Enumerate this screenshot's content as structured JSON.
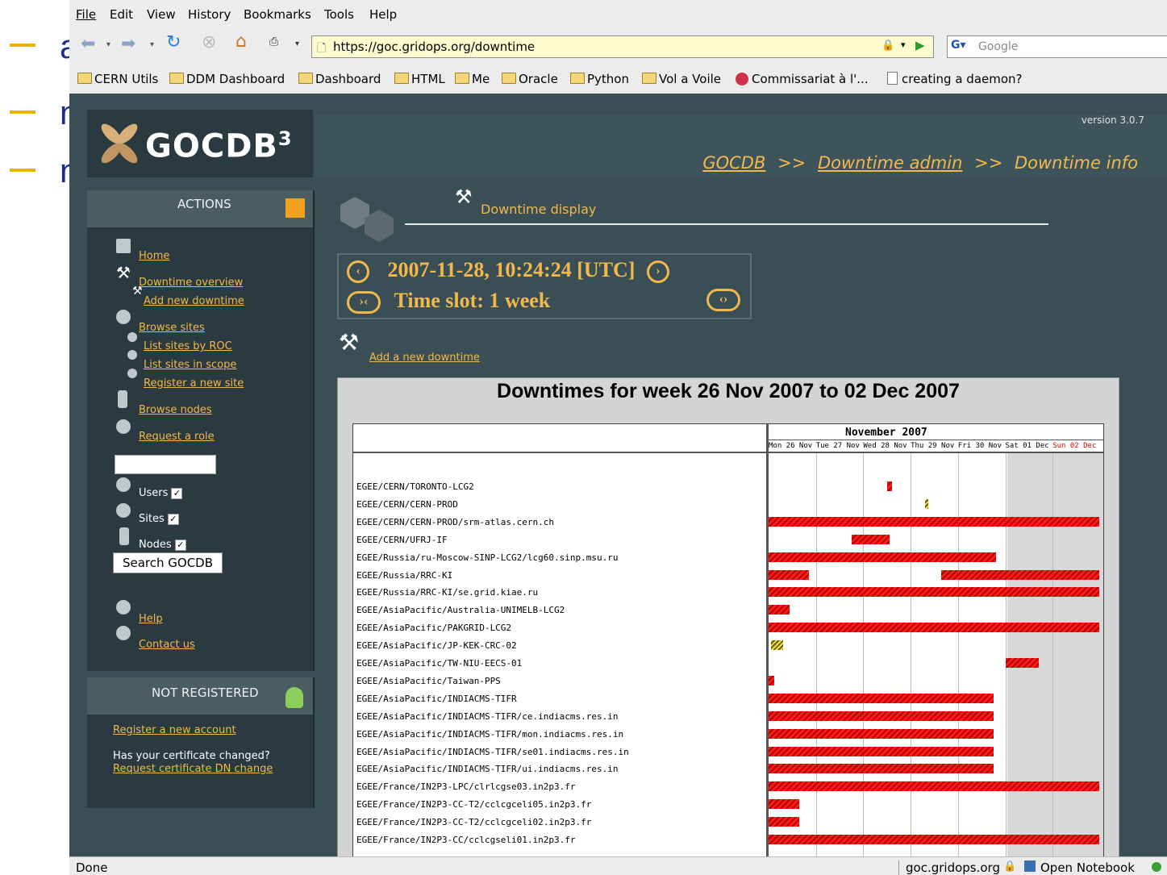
{
  "slide": {
    "chars": [
      "a",
      "n",
      "n"
    ]
  },
  "browser": {
    "menu": [
      "File",
      "Edit",
      "View",
      "History",
      "Bookmarks",
      "Tools",
      "Help"
    ],
    "url": "https://goc.gridops.org/downtime",
    "search_placeholder": "Google",
    "bookmarks": [
      "CERN Utils",
      "DDM Dashboard",
      "Dashboard",
      "HTML",
      "Me",
      "Oracle",
      "Python",
      "Vol a Voile",
      "Commissariat à l'...",
      "creating a daemon?"
    ],
    "status_left": "Done",
    "status_host": "goc.gridops.org",
    "status_notebook": "Open Notebook"
  },
  "site": {
    "logo_text": "GOCDB",
    "logo_sup": "3",
    "version": "version 3.0.7",
    "breadcrumb": {
      "home": "GOCDB",
      "sep": ">>",
      "admin": "Downtime admin",
      "info": "Downtime info"
    }
  },
  "actions": {
    "title": "ACTIONS",
    "home": "Home",
    "downtime_overview": "Downtime overview",
    "add_new_downtime": "Add new downtime",
    "browse_sites": "Browse sites",
    "list_sites_by_roc": "List sites by ROC",
    "list_sites_in_scope": "List sites in scope",
    "register_site": "Register a new site",
    "browse_nodes": "Browse nodes",
    "request_role": "Request a role",
    "search_value": "",
    "users_label": "Users",
    "sites_label": "Sites",
    "nodes_label": "Nodes",
    "search_button": "Search GOCDB",
    "help": "Help",
    "contact": "Contact us"
  },
  "account": {
    "title": "NOT REGISTERED",
    "register": "Register a new account",
    "cert_question": "Has your certificate changed?",
    "cert_link": "Request certificate DN change"
  },
  "main": {
    "section_title": "Downtime display",
    "datetime": "2007-11-28, 10:24:24 [UTC]",
    "timeslot": "Time slot: 1 week",
    "add_downtime": "Add a new downtime"
  },
  "calendar": {
    "title": "Downtimes for week 26 Nov 2007 to 02 Dec 2007",
    "month": "November 2007",
    "days": [
      "Mon 26 Nov",
      "Tue 27 Nov",
      "Wed 28 Nov",
      "Thu 29 Nov",
      "Fri 30 Nov",
      "Sat 01 Dec",
      "Sun 02 Dec"
    ],
    "rows": [
      {
        "name": "EGEE/CERN/TORONTO-LCG2",
        "bars": [
          {
            "start": 2.5,
            "end": 2.6,
            "kind": "r"
          }
        ]
      },
      {
        "name": "EGEE/CERN/CERN-PROD",
        "bars": [
          {
            "start": 3.3,
            "end": 3.35,
            "kind": "y"
          }
        ]
      },
      {
        "name": "EGEE/CERN/CERN-PROD/srm-atlas.cern.ch",
        "bars": [
          {
            "start": 0,
            "end": 7,
            "kind": "r"
          }
        ]
      },
      {
        "name": "EGEE/CERN/UFRJ-IF",
        "bars": [
          {
            "start": 1.75,
            "end": 2.55,
            "kind": "r"
          }
        ]
      },
      {
        "name": "EGEE/Russia/ru-Moscow-SINP-LCG2/lcg60.sinp.msu.ru",
        "bars": [
          {
            "start": 0,
            "end": 4.8,
            "kind": "r"
          }
        ]
      },
      {
        "name": "EGEE/Russia/RRC-KI",
        "bars": [
          {
            "start": 0,
            "end": 0.85,
            "kind": "r"
          },
          {
            "start": 3.65,
            "end": 7,
            "kind": "r"
          }
        ]
      },
      {
        "name": "EGEE/Russia/RRC-KI/se.grid.kiae.ru",
        "bars": [
          {
            "start": 0,
            "end": 7,
            "kind": "r"
          }
        ]
      },
      {
        "name": "EGEE/AsiaPacific/Australia-UNIMELB-LCG2",
        "bars": [
          {
            "start": 0,
            "end": 0.45,
            "kind": "r"
          }
        ]
      },
      {
        "name": "EGEE/AsiaPacific/PAKGRID-LCG2",
        "bars": [
          {
            "start": 0,
            "end": 7,
            "kind": "r"
          }
        ]
      },
      {
        "name": "EGEE/AsiaPacific/JP-KEK-CRC-02",
        "bars": [
          {
            "start": 0.05,
            "end": 0.3,
            "kind": "y"
          }
        ]
      },
      {
        "name": "EGEE/AsiaPacific/TW-NIU-EECS-01",
        "bars": [
          {
            "start": 5,
            "end": 5.7,
            "kind": "r"
          }
        ]
      },
      {
        "name": "EGEE/AsiaPacific/Taiwan-PPS",
        "bars": [
          {
            "start": 0,
            "end": 0.12,
            "kind": "r"
          }
        ]
      },
      {
        "name": "EGEE/AsiaPacific/INDIACMS-TIFR",
        "bars": [
          {
            "start": 0,
            "end": 4.75,
            "kind": "r"
          }
        ]
      },
      {
        "name": "EGEE/AsiaPacific/INDIACMS-TIFR/ce.indiacms.res.in",
        "bars": [
          {
            "start": 0,
            "end": 4.75,
            "kind": "r"
          }
        ]
      },
      {
        "name": "EGEE/AsiaPacific/INDIACMS-TIFR/mon.indiacms.res.in",
        "bars": [
          {
            "start": 0,
            "end": 4.75,
            "kind": "r"
          }
        ]
      },
      {
        "name": "EGEE/AsiaPacific/INDIACMS-TIFR/se01.indiacms.res.in",
        "bars": [
          {
            "start": 0,
            "end": 4.75,
            "kind": "r"
          }
        ]
      },
      {
        "name": "EGEE/AsiaPacific/INDIACMS-TIFR/ui.indiacms.res.in",
        "bars": [
          {
            "start": 0,
            "end": 4.75,
            "kind": "r"
          }
        ]
      },
      {
        "name": "EGEE/France/IN2P3-LPC/clrlcgse03.in2p3.fr",
        "bars": [
          {
            "start": 0,
            "end": 7,
            "kind": "r"
          }
        ]
      },
      {
        "name": "EGEE/France/IN2P3-CC-T2/cclcgceli05.in2p3.fr",
        "bars": [
          {
            "start": 0,
            "end": 0.65,
            "kind": "r"
          }
        ]
      },
      {
        "name": "EGEE/France/IN2P3-CC-T2/cclcgceli02.in2p3.fr",
        "bars": [
          {
            "start": 0,
            "end": 0.65,
            "kind": "r"
          }
        ]
      },
      {
        "name": "EGEE/France/IN2P3-CC/cclcgseli01.in2p3.fr",
        "bars": [
          {
            "start": 0,
            "end": 7,
            "kind": "r"
          }
        ]
      }
    ]
  },
  "colors": {
    "accent": "#f2b84b",
    "page_bg": "#3a4e55",
    "downtime": "#e00000",
    "warning": "#e8d83a"
  }
}
